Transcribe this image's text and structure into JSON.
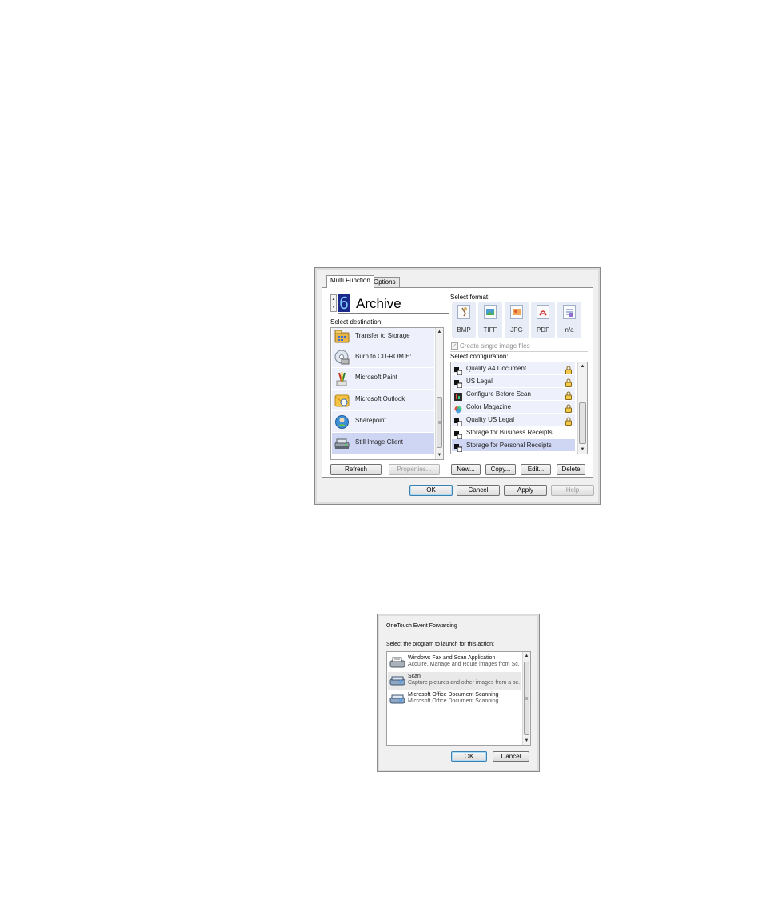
{
  "dialog1": {
    "tabs": [
      {
        "label": "Multi Function",
        "selected": true
      },
      {
        "label": "Options",
        "selected": false
      }
    ],
    "button_number": "6",
    "button_name": "Archive",
    "select_destination_label": "Select destination:",
    "destinations": [
      {
        "label": "Transfer to Storage",
        "icon": "storage-icon"
      },
      {
        "label": "Burn to CD-ROM  E:",
        "icon": "cd-icon"
      },
      {
        "label": "Microsoft Paint",
        "icon": "paint-icon"
      },
      {
        "label": "Microsoft Outlook",
        "icon": "outlook-icon"
      },
      {
        "label": "Sharepoint",
        "icon": "sharepoint-icon"
      },
      {
        "label": "Still Image Client",
        "icon": "scanner-icon",
        "selected": true
      }
    ],
    "refresh_label": "Refresh",
    "properties_label": "Properties...",
    "select_format_label": "Select format:",
    "formats": [
      {
        "label": "BMP",
        "icon": "bmp-file-icon"
      },
      {
        "label": "TIFF",
        "icon": "tiff-file-icon"
      },
      {
        "label": "JPG",
        "icon": "jpg-file-icon"
      },
      {
        "label": "PDF",
        "icon": "pdf-file-icon"
      },
      {
        "label": "n/a",
        "icon": "text-file-icon"
      }
    ],
    "create_single_label": "Create single image files",
    "create_single_checked": true,
    "select_configuration_label": "Select configuration:",
    "configurations": [
      {
        "label": "Quality A4 Document",
        "locked": true
      },
      {
        "label": "US Legal",
        "locked": true
      },
      {
        "label": "Configure Before Scan",
        "locked": true
      },
      {
        "label": "Color Magazine",
        "locked": true
      },
      {
        "label": "Quality US Legal",
        "locked": true
      },
      {
        "label": "Storage for Business Receipts",
        "locked": false
      },
      {
        "label": "Storage for Personal Receipts",
        "locked": false,
        "selected": true
      }
    ],
    "new_label": "New...",
    "copy_label": "Copy...",
    "edit_label": "Edit...",
    "delete_label": "Delete",
    "ok_label": "OK",
    "cancel_label": "Cancel",
    "apply_label": "Apply",
    "help_label": "Help"
  },
  "dialog2": {
    "title": "OneTouch Event Forwarding",
    "prompt": "Select the program to launch for this action:",
    "programs": [
      {
        "name": "Windows Fax and Scan Application",
        "desc": "Acquire, Manage and Route images from Sc...",
        "icon": "fax-scanner-icon"
      },
      {
        "name": "Scan",
        "desc": "Capture pictures and other images from a sc...",
        "icon": "scanner-icon",
        "selected": true
      },
      {
        "name": "Microsoft Office Document Scanning",
        "desc": "Microsoft Office Document Scanning",
        "icon": "scanner-icon"
      }
    ],
    "ok_label": "OK",
    "cancel_label": "Cancel"
  }
}
